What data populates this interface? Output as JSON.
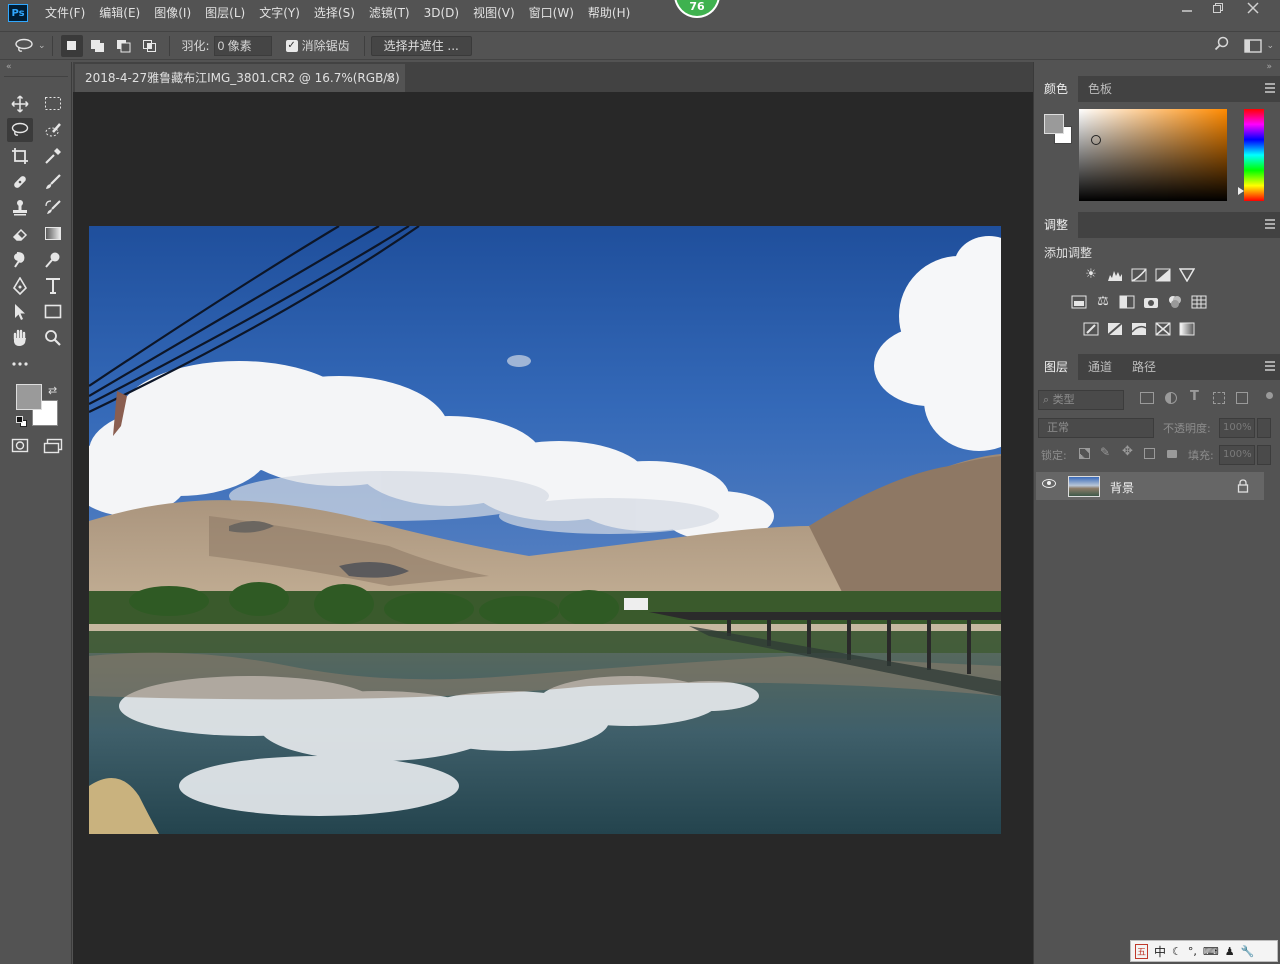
{
  "menu": {
    "app_logo": "Ps",
    "items": [
      "文件(F)",
      "编辑(E)",
      "图像(I)",
      "图层(L)",
      "文字(Y)",
      "选择(S)",
      "滤镜(T)",
      "3D(D)",
      "视图(V)",
      "窗口(W)",
      "帮助(H)"
    ],
    "badge": "76"
  },
  "options": {
    "feather_label": "羽化:",
    "feather_value": "0 像素",
    "antialias_label": "消除锯齿",
    "select_mask_label": "选择并遮住 ..."
  },
  "document": {
    "tab_title": "2018-4-27雅鲁藏布江IMG_3801.CR2 @ 16.7%(RGB/8)",
    "close_glyph": "×"
  },
  "panels": {
    "color_tabs": [
      "颜色",
      "色板"
    ],
    "adjust_tab": "调整",
    "add_adjust_label": "添加调整",
    "layers_tabs": [
      "图层",
      "通道",
      "路径"
    ],
    "kind_placeholder": "类型",
    "blend_mode": "正常",
    "opacity_label": "不透明度:",
    "opacity_value": "100%",
    "lock_label": "锁定:",
    "fill_label": "填充:",
    "fill_value": "100%",
    "layer_name": "背景"
  },
  "colors": {
    "foreground": "#9a9a9a",
    "background": "#ffffff",
    "accent_badge": "#3fb24f"
  },
  "icons": {
    "tools": [
      "move-icon",
      "marquee-icon",
      "lasso-icon",
      "quick-select-icon",
      "crop-icon",
      "eyedropper-icon",
      "healing-brush-icon",
      "brush-icon",
      "clone-stamp-icon",
      "history-brush-icon",
      "eraser-icon",
      "gradient-icon",
      "blur-icon",
      "dodge-icon",
      "pen-icon",
      "type-icon",
      "path-select-icon",
      "rectangle-icon",
      "hand-icon",
      "zoom-icon",
      "more-tools-icon"
    ]
  },
  "ime": {
    "label": "中"
  }
}
